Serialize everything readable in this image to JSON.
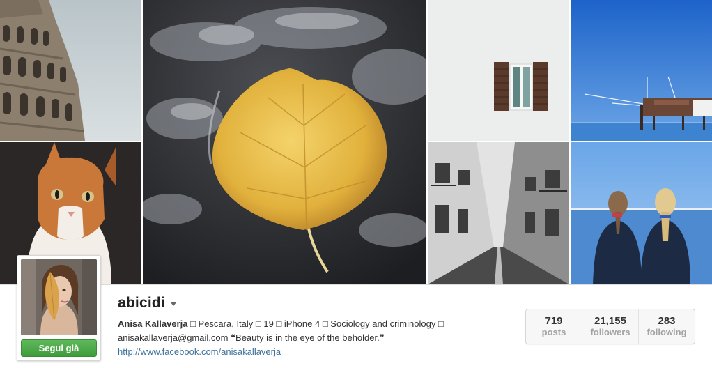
{
  "photos": [
    {
      "subject": "colosseum"
    },
    {
      "subject": "yellow leaf in water"
    },
    {
      "subject": "shuttered window"
    },
    {
      "subject": "fishing pier over sea"
    },
    {
      "subject": "cat portrait"
    },
    {
      "subject": "narrow street"
    },
    {
      "subject": "two girls at the sea"
    }
  ],
  "profile": {
    "username": "abicidi",
    "full_name": "Anisa Kallaverja",
    "bio_line_1": " □ Pescara, Italy □ 19 □ iPhone 4 □ Sociology and criminology □",
    "bio_line_2": "anisakallaverja@gmail.com ❝Beauty is in the eye of the beholder.❞",
    "website": "http://www.facebook.com/anisakallaverja",
    "follow_label": "Segui già"
  },
  "stats": [
    {
      "value": "719",
      "label": "posts"
    },
    {
      "value": "21,155",
      "label": "followers"
    },
    {
      "value": "283",
      "label": "following"
    }
  ],
  "colors": {
    "follow_green": "#4caf4a",
    "link_blue": "#3f729b",
    "stat_label_gray": "#a3a3a3"
  },
  "icons": {
    "username_menu": "caret-down-icon"
  }
}
